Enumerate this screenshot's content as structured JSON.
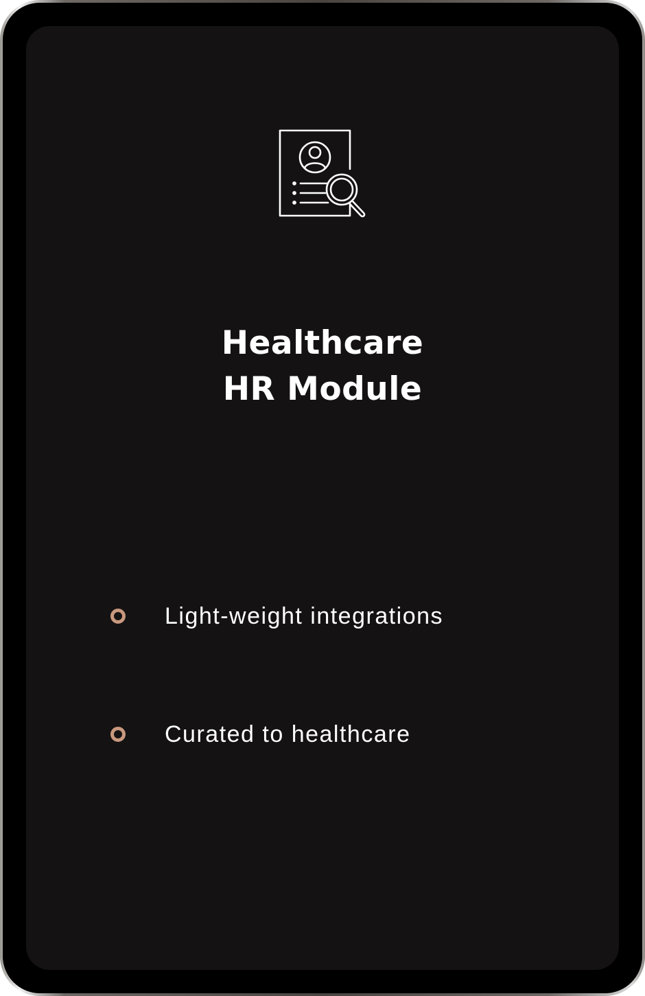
{
  "card": {
    "icon": "profile-search-document-icon",
    "title_line1": "Healthcare",
    "title_line2": "HR Module",
    "features": [
      {
        "label": "Light-weight integrations",
        "icon": "ring-bullet-icon"
      },
      {
        "label": "Curated to healthcare",
        "icon": "ring-bullet-icon"
      }
    ]
  },
  "colors": {
    "screen_background": "#141213",
    "text": "#ffffff",
    "bullet_accent": "#c9987e",
    "bezel": "#000000"
  }
}
